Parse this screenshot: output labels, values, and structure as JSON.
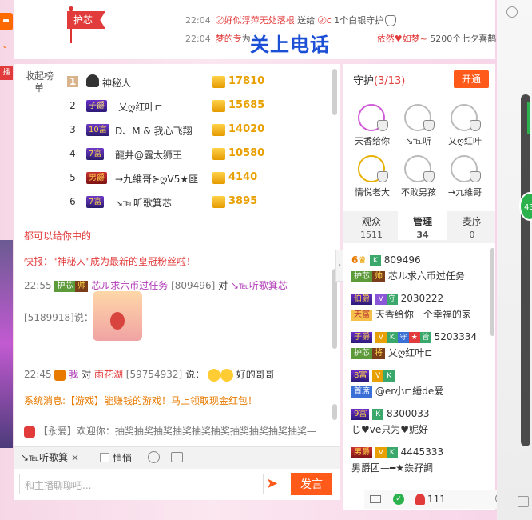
{
  "notices": [
    {
      "time": "22:04",
      "user": "〄好似浮萍无处落根",
      "action": "送给",
      "target": "〄c",
      "gift": "1个白银守护"
    },
    {
      "time": "22:04",
      "text_red": "梦的专",
      "text_mid": "为上",
      "text_red2": "依然♥如梦~",
      "count": "5200个七夕喜鹊"
    }
  ],
  "overlay_text": "关上电话",
  "flag_label": "护芯",
  "left_tag": "播",
  "rank": {
    "label": "收起榜单",
    "rows": [
      {
        "num": "1",
        "badge": "",
        "name": "神秘人",
        "value": "17810"
      },
      {
        "num": "2",
        "badge": "子爵",
        "name": "乂ღ红叶⊏",
        "value": "15685"
      },
      {
        "num": "3",
        "badge": "10富",
        "name": "D、M & 我心飞翔",
        "value": "14020"
      },
      {
        "num": "4",
        "badge": "7富",
        "name": "龍井@露太狮王",
        "value": "10580"
      },
      {
        "num": "5",
        "badge": "男爵",
        "name": "→九維哥⊱ღV5★匪",
        "value": "4140"
      },
      {
        "num": "6",
        "badge": "7富",
        "name": "↘℡听歌箕芯",
        "value": "3895"
      }
    ]
  },
  "chat": {
    "line_hidden": "都可以给你中的",
    "flash": "快报：\"神秘人\"成为最新的皇冠粉丝啦！",
    "msg1": {
      "time": "22:55",
      "guard": "护芯",
      "lvl": "帅",
      "user": "芯ル求六币过任务",
      "uid": "[809496]",
      "to": "对",
      "target": "↘℡听歌箕芯",
      "uid2": "[5189918]",
      "says": "说："
    },
    "msg2": {
      "time": "22:45",
      "user": "我",
      "to": "对",
      "target": "雨花湖",
      "uid": "[59754932]",
      "says": "说：",
      "text": "好的哥哥"
    },
    "system": "系统消息:【游戏】能赚钱的游戏！马上领取现金红包！",
    "welcome": "【永爱】欢迎你：抽奖抽奖抽奖抽奖抽奖抽奖抽奖抽奖抽奖抽奖—"
  },
  "input": {
    "target_chip": "↘℡听歌箕",
    "chip_close": "×",
    "quiet_label": "悄悄",
    "placeholder": "和主播聊聊吧...",
    "send_label": "发言"
  },
  "guard_panel": {
    "title": "守护",
    "count": "(3/13)",
    "open_label": "开通",
    "members": [
      {
        "name": "天香给你"
      },
      {
        "name": "↘℡听"
      },
      {
        "name": "乂ღ红叶"
      },
      {
        "name": "情悦老大"
      },
      {
        "name": "不败男孩"
      },
      {
        "name": "→九維哥"
      }
    ]
  },
  "tabs": [
    {
      "label": "观众",
      "count": "1511"
    },
    {
      "label": "管理",
      "count": "34"
    },
    {
      "label": "麦序",
      "count": "0"
    }
  ],
  "members": [
    {
      "prefix": "6",
      "id": "809496",
      "guard": "护芯",
      "lvl": "帅",
      "name": "芯ル求六币过任务"
    },
    {
      "prefix": "伯爵",
      "id": "2030222",
      "guard": "天富",
      "name": "天香给你一个幸福的家"
    },
    {
      "prefix": "子爵",
      "id": "5203334",
      "guard": "护芯",
      "lvl": "将",
      "name": "乂ღ红叶⊏"
    },
    {
      "prefix": "8富",
      "id": "",
      "guard": "首席",
      "name": "@er小⊏綞de爱"
    },
    {
      "prefix": "9富",
      "id": "8300033",
      "name": "じ♥ve只为♥妮好"
    },
    {
      "prefix": "男爵",
      "id": "4445333",
      "name": "男爵团—━★鉄孖調"
    }
  ],
  "footer": {
    "online": "111"
  },
  "far_right_badge": "43"
}
